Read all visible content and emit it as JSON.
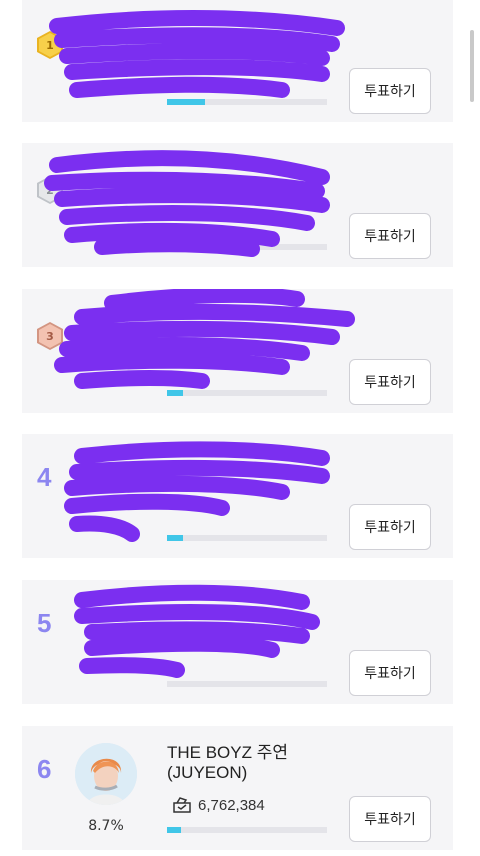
{
  "accent_color": "#8c86f0",
  "progress_color": "#40c6e8",
  "redaction_color": "#7b2ff0",
  "entries": [
    {
      "rank": "1",
      "badge": "gold-hex-icon",
      "vote_label": "투표하기",
      "share": 0.24
    },
    {
      "rank": "2",
      "badge": "silver-hex-icon",
      "vote_label": "투표하기",
      "share": 0.0
    },
    {
      "rank": "3",
      "badge": "bronze-hex-icon",
      "vote_label": "투표하기",
      "share": 0.1
    },
    {
      "rank": "4",
      "vote_label": "투표하기",
      "share": 0.1
    },
    {
      "rank": "5",
      "vote_label": "투표하기",
      "share": 0.0
    },
    {
      "rank": "6",
      "name_line1": "THE BOYZ 주연",
      "name_line2": "(JUYEON)",
      "votes": "6,762,384",
      "percent": "8.7%",
      "vote_label": "투표하기",
      "share": 0.087
    }
  ]
}
